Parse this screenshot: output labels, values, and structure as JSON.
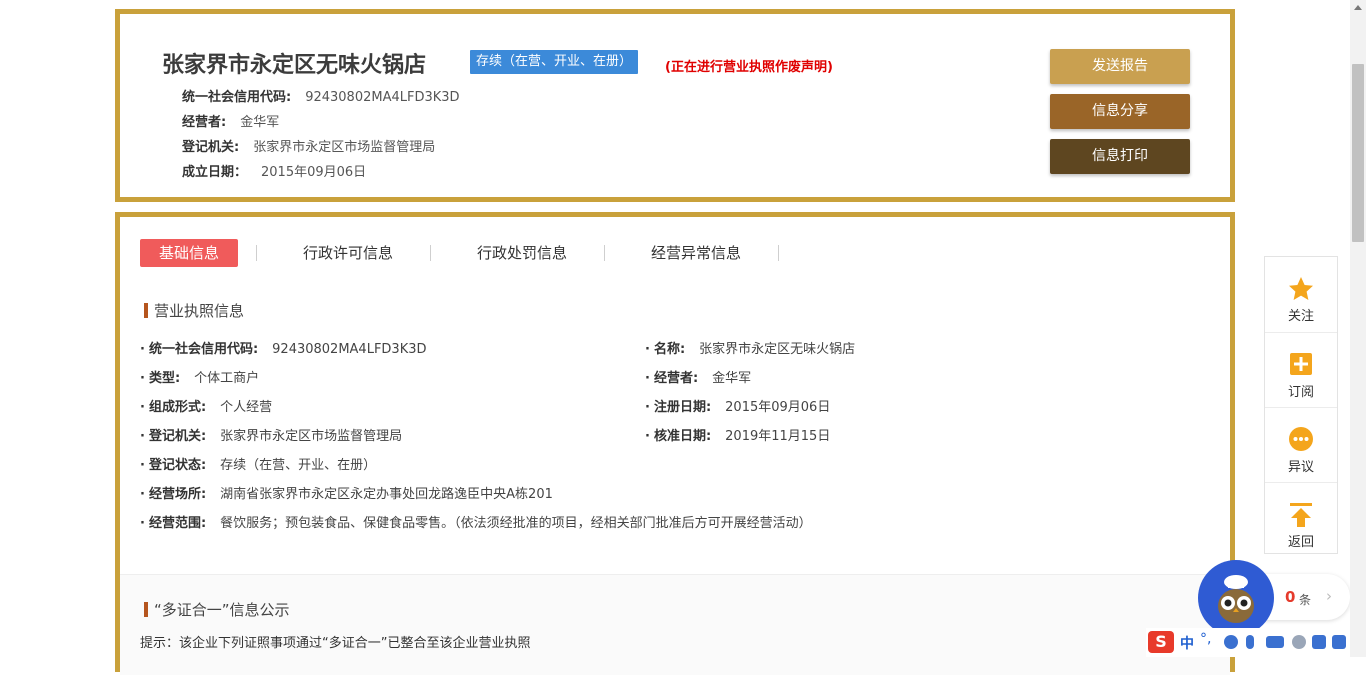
{
  "header": {
    "company_name": "张家界市永定区无味火锅店",
    "status_badge": "存续（在营、开业、在册）",
    "notice": "(正在进行营业执照作废声明)",
    "info": [
      {
        "label": "统一社会信用代码:",
        "value": "92430802MA4LFD3K3D"
      },
      {
        "label": "经营者:",
        "value": "金华军"
      },
      {
        "label": "登记机关:",
        "value": "张家界市永定区市场监督管理局"
      },
      {
        "label": "成立日期：",
        "value": "2015年09月06日"
      }
    ],
    "buttons": {
      "send": "发送报告",
      "share": "信息分享",
      "print": "信息打印"
    }
  },
  "tabs": [
    {
      "label": "基础信息",
      "active": true
    },
    {
      "label": "行政许可信息",
      "active": false
    },
    {
      "label": "行政处罚信息",
      "active": false
    },
    {
      "label": "经营异常信息",
      "active": false
    }
  ],
  "license_section": {
    "title": "营业执照信息",
    "fields": [
      {
        "label": "统一社会信用代码:",
        "value": "92430802MA4LFD3K3D"
      },
      {
        "label": "名称:",
        "value": "张家界市永定区无味火锅店"
      },
      {
        "label": "类型:",
        "value": "个体工商户"
      },
      {
        "label": "经营者:",
        "value": "金华军"
      },
      {
        "label": "组成形式:",
        "value": "个人经营"
      },
      {
        "label": "注册日期:",
        "value": "2015年09月06日"
      },
      {
        "label": "登记机关:",
        "value": "张家界市永定区市场监督管理局"
      },
      {
        "label": "核准日期:",
        "value": "2019年11月15日"
      },
      {
        "label": "登记状态:",
        "value": "存续（在营、开业、在册）"
      },
      {
        "label": "经营场所:",
        "value": "湖南省张家界市永定区永定办事处回龙路逸臣中央A栋201"
      },
      {
        "label": "经营范围:",
        "value": "餐饮服务；预包装食品、保健食品零售。（依法须经批准的项目，经相关部门批准后方可开展经营活动）"
      }
    ]
  },
  "multi_cert_section": {
    "title": "“多证合一”信息公示",
    "hint": "提示：该企业下列证照事项通过“多证合一”已整合至该企业营业执照"
  },
  "side_panel": {
    "items": [
      {
        "label": "关注",
        "icon": "star-icon"
      },
      {
        "label": "订阅",
        "icon": "subscribe-plus-icon"
      },
      {
        "label": "异议",
        "icon": "chat-bubble-icon"
      },
      {
        "label": "返回",
        "icon": "arrow-up-icon"
      }
    ]
  },
  "counter": {
    "count": "0",
    "unit": "条"
  },
  "ime": {
    "logo": "S",
    "lang": "中",
    "punct": "°,"
  },
  "colors": {
    "gold_border": "#c9a13b",
    "tab_active": "#f05b5b",
    "status_blue": "#3c8ad9",
    "notice_red": "#e00000",
    "btn_send": "#c9a050",
    "btn_share": "#9a6528",
    "btn_print": "#5e4620",
    "section_bar": "#b5551e"
  }
}
